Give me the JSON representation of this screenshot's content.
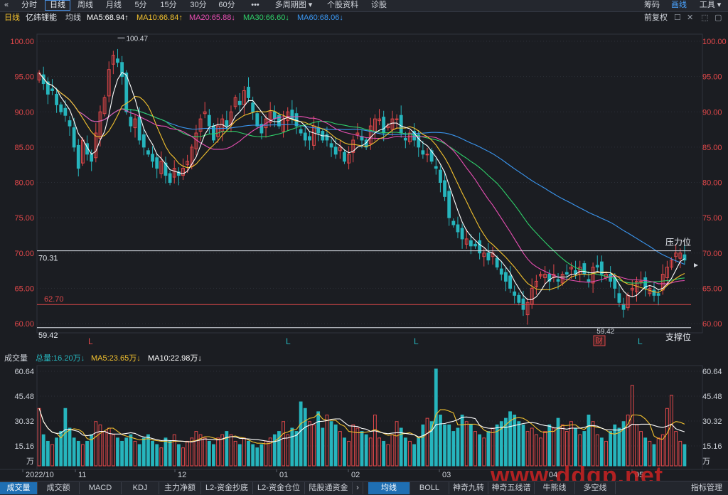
{
  "topbar": {
    "back_icon": "chevron-left-icon",
    "tabs": [
      "分时",
      "日线",
      "周线",
      "月线",
      "5分",
      "15分",
      "30分",
      "60分",
      "•••",
      "多周期图",
      "个股资料",
      "诊股"
    ],
    "active_tab": "日线",
    "right_items": [
      "筹码",
      "画线",
      "工具"
    ],
    "active_right": "画线"
  },
  "ma_legend": {
    "period": "日线",
    "stock_name": "亿纬锂能",
    "label": "均线",
    "ma5": "MA5:68.94↑",
    "ma10": "MA10:66.84↑",
    "ma20": "MA20:65.88↓",
    "ma30": "MA30:66.60↓",
    "ma60": "MA60:68.06↓",
    "adjust": "前复权",
    "colors": {
      "ma5": "#ffffff",
      "ma10": "#f2c12e",
      "ma20": "#e94fb4",
      "ma30": "#2fd06a",
      "ma60": "#3a96f0",
      "up": "#e2484a",
      "down": "#26b5bd"
    }
  },
  "price_chart": {
    "y_ticks": [
      "100.00",
      "95.00",
      "90.00",
      "85.00",
      "80.00",
      "75.00",
      "70.00",
      "65.00",
      "60.00"
    ],
    "high_marker": "100.47",
    "low_marker": "59.42",
    "line_70": "70.31",
    "line_62": "62.70",
    "line_59": "59.42",
    "resistance_label": "压力位",
    "support_label": "支撑位",
    "signals": [
      "L",
      "L",
      "L",
      "L"
    ],
    "finance_badge": "财"
  },
  "vol_legend": {
    "label": "成交量",
    "total": "总量:16.20万↓",
    "ma5": "MA5:23.65万↓",
    "ma10": "MA10:22.98万↓"
  },
  "vol_chart": {
    "y_ticks": [
      "60.64",
      "45.48",
      "30.32",
      "15.16"
    ],
    "unit": "万"
  },
  "x_axis": {
    "labels": [
      "2022/10",
      "11",
      "12",
      "01",
      "02",
      "03",
      "04",
      "05"
    ]
  },
  "bottom_tabs": {
    "left": [
      "成交量",
      "成交额",
      "MACD",
      "KDJ",
      "主力净额",
      "L2-资金抄底",
      "L2-资金仓位",
      "陆股通资金"
    ],
    "right": [
      "均线",
      "BOLL",
      "神奇九转",
      "神奇五线谱",
      "牛熊线",
      "多空线",
      "指标管理"
    ],
    "active_left": "成交量",
    "active_right": "均线"
  },
  "watermark": "www.ddgp.net",
  "chart_data": {
    "type": "candlestick",
    "x_labels": [
      "2022/10",
      "11",
      "12",
      "01",
      "02",
      "03",
      "04",
      "05"
    ],
    "ylim_price": [
      59,
      101
    ],
    "ylim_volume": [
      0,
      65
    ],
    "close": [
      95.5,
      94,
      92.5,
      93,
      91,
      90,
      89.5,
      88,
      85,
      82,
      86,
      84,
      83,
      87,
      90,
      92,
      96,
      98,
      97,
      95,
      90,
      88,
      89,
      86,
      85,
      84,
      83,
      82,
      83,
      81,
      80,
      82,
      81,
      82,
      83,
      85,
      87,
      89,
      90,
      88,
      86,
      88,
      89,
      88,
      90,
      92,
      91,
      93,
      92,
      90,
      88,
      87,
      89,
      90,
      89,
      88,
      89,
      90,
      89,
      88,
      87,
      86,
      86,
      88,
      87,
      86,
      86,
      85,
      84,
      85,
      83,
      84,
      86,
      87,
      86,
      85,
      88,
      89,
      89,
      87,
      88,
      89,
      89,
      87,
      86,
      87,
      86,
      85,
      84,
      84,
      83,
      82,
      80,
      78,
      75,
      74,
      73,
      72,
      72,
      71,
      71,
      70,
      70,
      69,
      70,
      68,
      67,
      66,
      65,
      64,
      63,
      62,
      63,
      65,
      66,
      67,
      67,
      66,
      67,
      66,
      67,
      67,
      68,
      67,
      68,
      67,
      66,
      68,
      68,
      67,
      67,
      66,
      65,
      63,
      62,
      64,
      65,
      66,
      66,
      65,
      65,
      64,
      64,
      67,
      68,
      69,
      70,
      70,
      69
    ],
    "volume": [
      38,
      22,
      18,
      16,
      20,
      24,
      38,
      26,
      20,
      18,
      16,
      18,
      22,
      30,
      28,
      24,
      26,
      22,
      20,
      18,
      20,
      22,
      18,
      16,
      20,
      22,
      18,
      16,
      14,
      20,
      18,
      22,
      16,
      14,
      18,
      20,
      24,
      22,
      20,
      18,
      16,
      20,
      22,
      24,
      22,
      18,
      16,
      20,
      18,
      16,
      14,
      16,
      18,
      20,
      22,
      24,
      30,
      22,
      26,
      24,
      42,
      38,
      30,
      28,
      36,
      26,
      34,
      30,
      28,
      24,
      20,
      18,
      28,
      26,
      24,
      22,
      20,
      34,
      20,
      18,
      16,
      22,
      30,
      26,
      20,
      18,
      16,
      20,
      28,
      32,
      30,
      62,
      34,
      28,
      28,
      24,
      26,
      34,
      30,
      28,
      24,
      22,
      20,
      24,
      26,
      28,
      30,
      32,
      36,
      34,
      30,
      28,
      24,
      26,
      22,
      20,
      24,
      28,
      26,
      32,
      28,
      24,
      30,
      26,
      22,
      24,
      34,
      30,
      22,
      20,
      18,
      24,
      28,
      26,
      30,
      34,
      52,
      28,
      24,
      20,
      18,
      16,
      20,
      22,
      38,
      46,
      24,
      18,
      16
    ],
    "series": [
      {
        "name": "MA5",
        "value": 68.94
      },
      {
        "name": "MA10",
        "value": 66.84
      },
      {
        "name": "MA20",
        "value": 65.88
      },
      {
        "name": "MA30",
        "value": 66.6
      },
      {
        "name": "MA60",
        "value": 68.06
      }
    ],
    "annotations": {
      "high": 100.47,
      "low": 59.42,
      "resistance": 70.31,
      "level_62": 62.7,
      "support": 59.42
    }
  }
}
